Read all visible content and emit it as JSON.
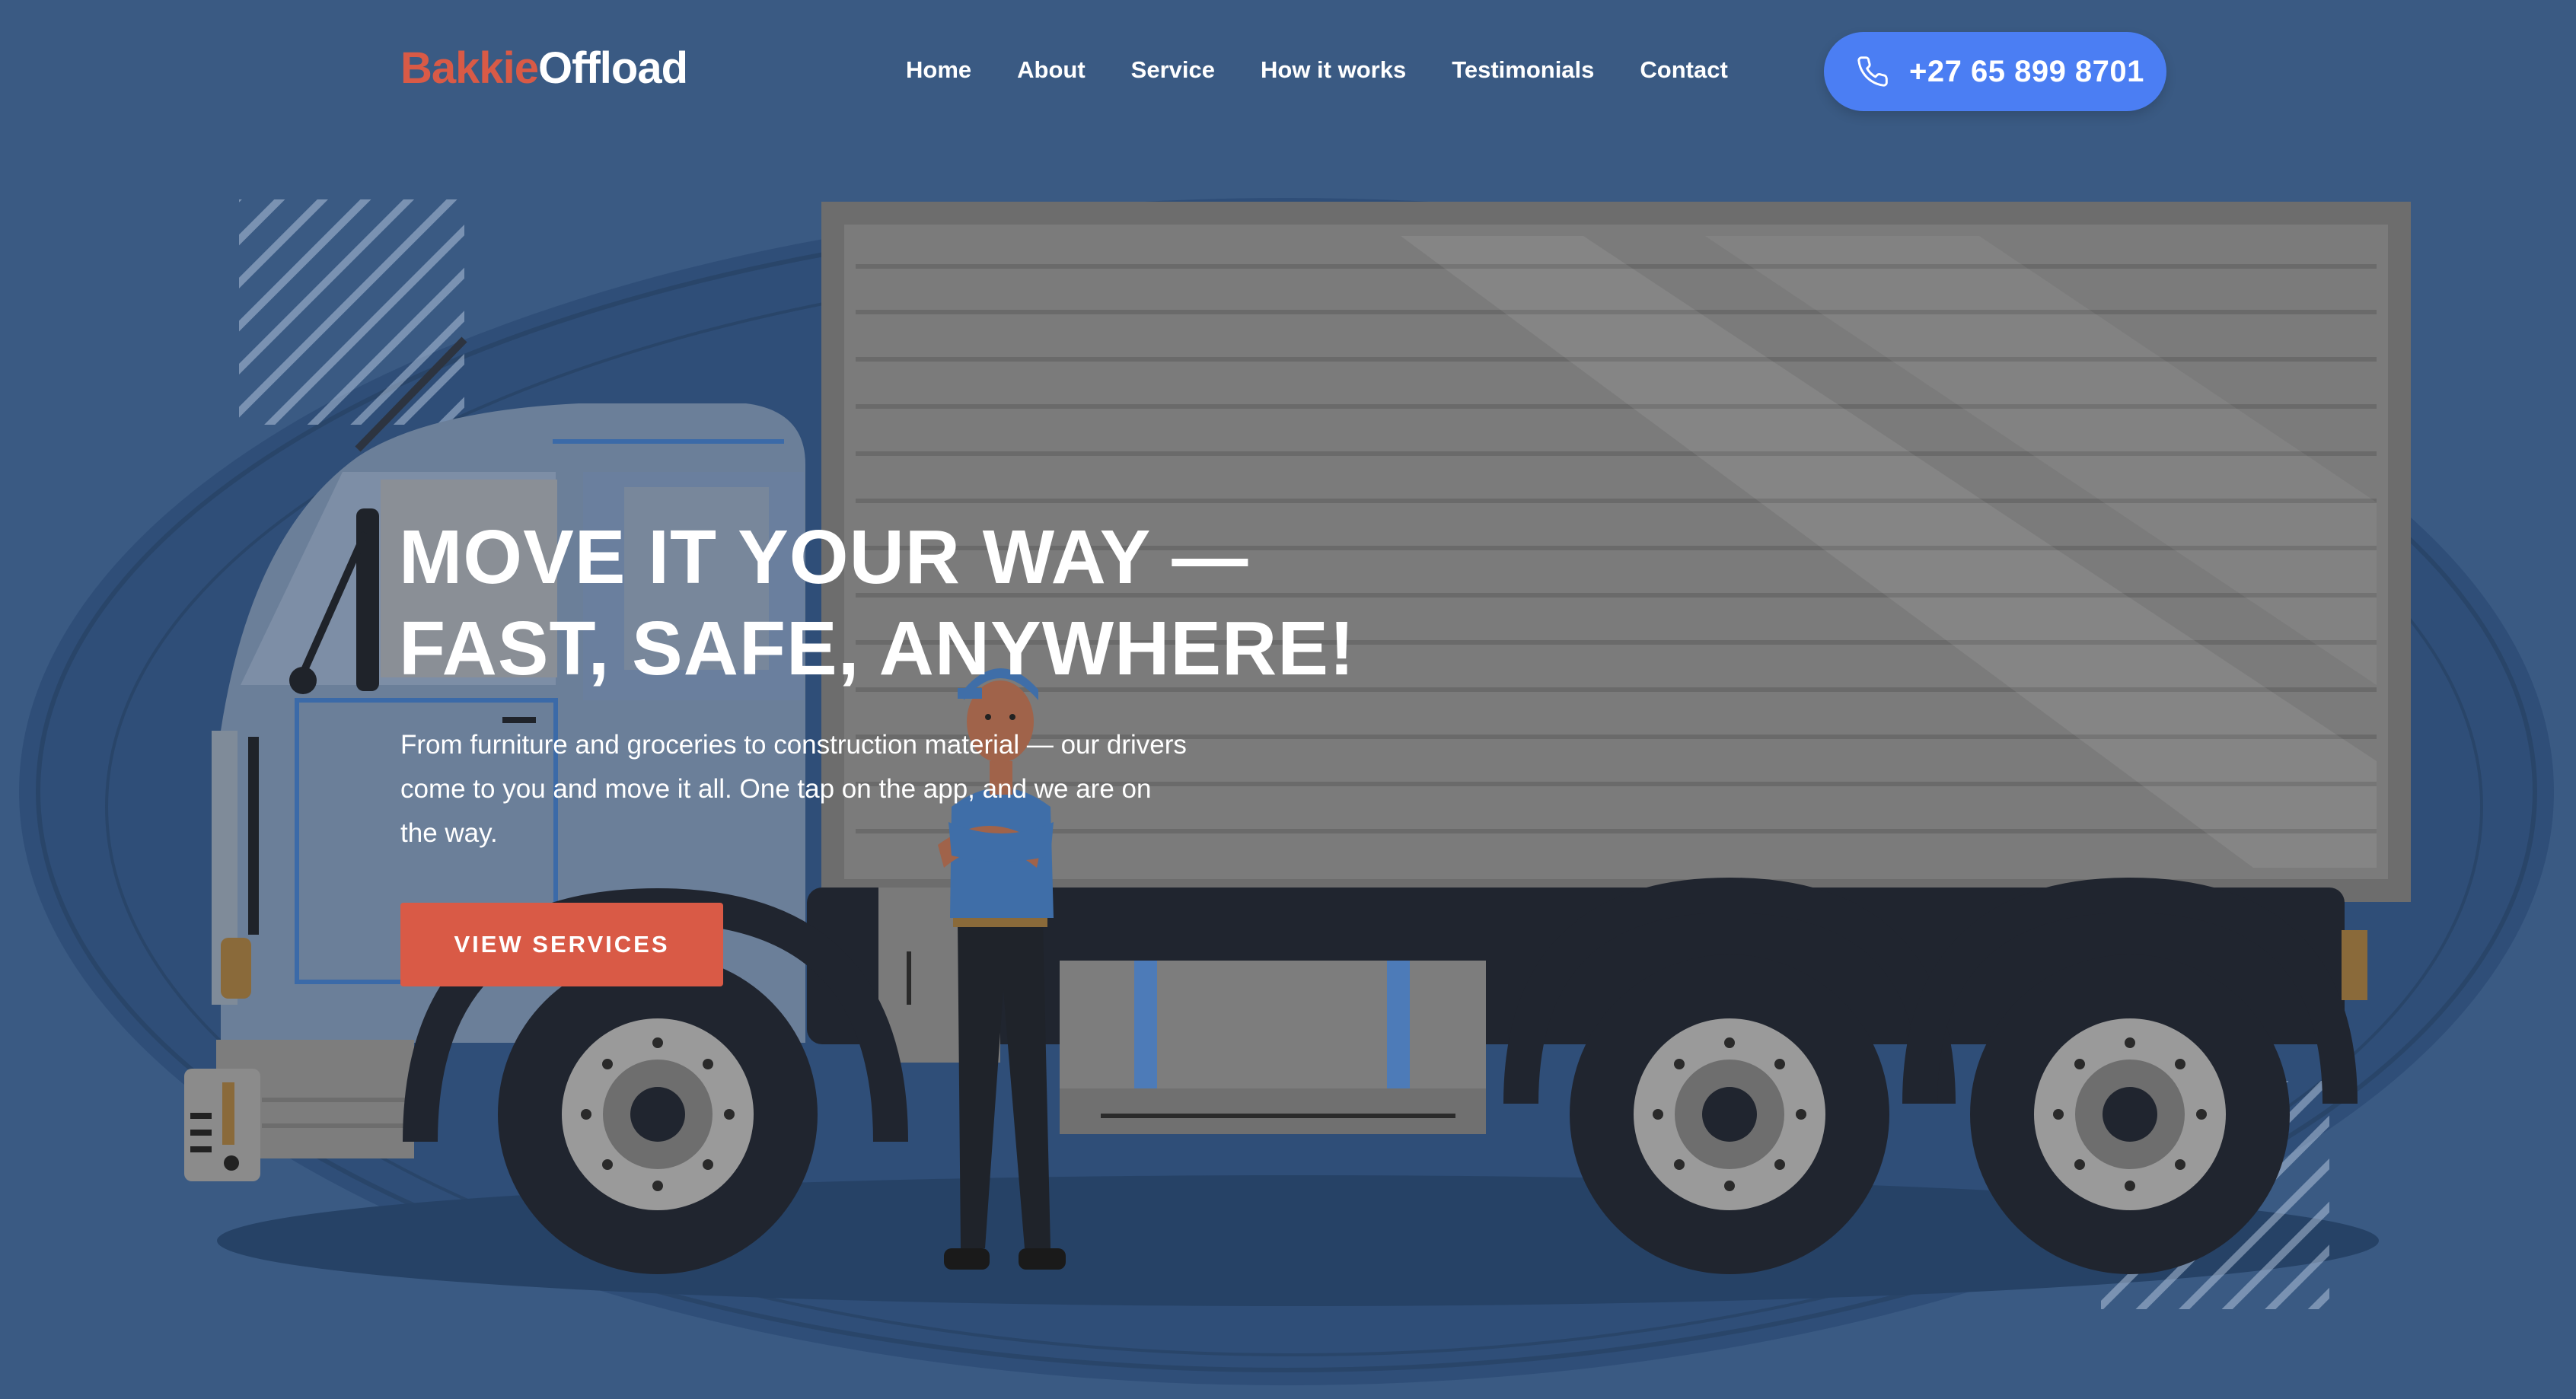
{
  "brand": {
    "part1": "Bakkie",
    "part2": "Offload"
  },
  "nav": {
    "items": [
      {
        "label": "Home"
      },
      {
        "label": "About"
      },
      {
        "label": "Service"
      },
      {
        "label": "How it works"
      },
      {
        "label": "Testimonials"
      },
      {
        "label": "Contact"
      }
    ]
  },
  "phone": {
    "number": "+27 65 899 8701",
    "icon": "phone-icon"
  },
  "hero": {
    "headline_line1": "MOVE IT YOUR WAY —",
    "headline_line2": "FAST, SAFE, ANYWHERE!",
    "lede": "From furniture and groceries to construction material — our drivers come to you and move it all. One tap on the app, and we are on the way.",
    "cta_label": "VIEW SERVICES"
  },
  "colors": {
    "background": "#3a5a83",
    "brand_accent": "#d95a46",
    "phone_button": "#4b7ef3",
    "text": "#ffffff"
  }
}
